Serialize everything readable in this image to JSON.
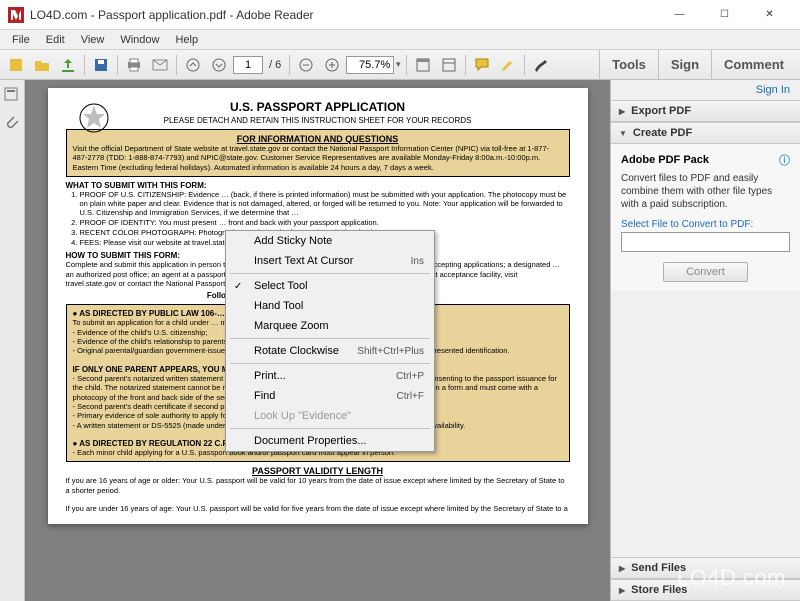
{
  "window": {
    "title": "LO4D.com - Passport application.pdf - Adobe Reader"
  },
  "menubar": [
    "File",
    "Edit",
    "View",
    "Window",
    "Help"
  ],
  "toolbar": {
    "page_current": "1",
    "page_total": "/ 6",
    "zoom": "75.7%"
  },
  "toolbar_tabs": {
    "tools": "Tools",
    "sign": "Sign",
    "comment": "Comment"
  },
  "right": {
    "signin": "Sign In",
    "export": "Export PDF",
    "create": "Create PDF",
    "pack_title": "Adobe PDF Pack",
    "pack_desc": "Convert files to PDF and easily combine them with other file types with a paid subscription.",
    "select_label": "Select File to Convert to PDF:",
    "convert": "Convert",
    "send": "Send Files",
    "store": "Store Files"
  },
  "context_menu": {
    "add_sticky": "Add Sticky Note",
    "insert_text": "Insert Text At Cursor",
    "insert_text_sc": "Ins",
    "select_tool": "Select Tool",
    "hand_tool": "Hand Tool",
    "marquee_zoom": "Marquee Zoom",
    "rotate_cw": "Rotate Clockwise",
    "rotate_cw_sc": "Shift+Ctrl+Plus",
    "print": "Print...",
    "print_sc": "Ctrl+P",
    "find": "Find",
    "find_sc": "Ctrl+F",
    "lookup": "Look Up \"Evidence\"",
    "doc_props": "Document Properties..."
  },
  "doc": {
    "title": "U.S. PASSPORT APPLICATION",
    "subtitle": "PLEASE DETACH AND RETAIN THIS INSTRUCTION SHEET FOR YOUR RECORDS",
    "info_hdr": "FOR INFORMATION AND QUESTIONS",
    "info_body": "Visit the official Department of State website at travel.state.gov or contact the National Passport Information Center (NPIC) via toll-free at 1-877-487-2778 (TDD: 1-888-874-7793) and NPIC@state.gov.  Customer Service Representatives are available Monday-Friday 8:00a.m.-10:00p.m. Eastern Time (excluding federal holidays). Automated information is available 24 hours a day, 7 days a week.",
    "what_submit": "WHAT TO SUBMIT WITH THIS FORM:",
    "what_items": [
      "PROOF OF U.S. CITIZENSHIP: Evidence … (back, if there is printed information) must be submitted with your application. The photocopy must be on plain white paper and clear. Evidence that is not damaged, altered, or forged will be returned to you. Note: Your application will be forwarded to U.S. Citizenship and Immigration Services, if we determine that …",
      "PROOF OF IDENTITY: You must present … front and back with your passport application.",
      "RECENT COLOR PHOTOGRAPH: Photograph must be … the face and 2x2 inches in size.",
      "FEES: Please visit our website at travel.state.gov."
    ],
    "how_submit": "HOW TO SUBMIT THIS FORM:",
    "how_body": "Complete and submit this application in person to a state court of record or a judge or clerk of a probate court accepting applications; a designated … an authorized post office; an agent at a passport agency (by appointment only); or a U.S. … To find your nearest acceptance facility, visit travel.state.gov or contact the National Passport Information Center.",
    "follow": "Follow the instructions on … and submission of this form.",
    "law_hdr": "AS DIRECTED BY PUBLIC LAW 106-…",
    "law_body1": "To submit an application for a child under … must appear and present the following:",
    "law_items": [
      "Evidence of the child's U.S. citizenship;",
      "Evidence of the child's relationship to parents/guardian(s); AND",
      "Original parental/guardian government-issued identification AND a photocopy of the front and back side of presented identification."
    ],
    "one_parent_hdr": "IF ONLY ONE PARENT APPEARS, YOU MUST ALSO SUBMIT ONE OF THE FOLLOWING:",
    "one_parent_items": [
      "Second parent's notarized written statement or DS-3053 (including the child's full name and date of birth) consenting to the passport issuance for the child. The notarized statement cannot be more than three months old and must be signed and notarized on a form and must come with a photocopy of the front and back side of the second parent's government-issued photo identification; OR",
      "Second parent's death certificate if second parent is deceased; OR",
      "Primary evidence of sole authority to apply for the child; OR",
      "A written statement or DS-5525 (made under penalty of perjury) explaining in detail the second parent's unavailability."
    ],
    "reg_hdr": "AS DIRECTED BY REGULATION 22 C.F.R. 51.21 AND 51.28:",
    "reg_item": "Each minor child applying for a U.S. passport book and/or passport card must appear in person.",
    "validity_hdr": "PASSPORT VALIDITY LENGTH",
    "validity_16_over": "If you are 16 years of age or older: Your U.S. passport will be valid for 10 years from the date of issue except where limited by the Secretary of State to a shorter period.",
    "validity_16_under": "If you are under 16 years of age: Your U.S. passport will be valid for five years from the date of issue except where limited by the Secretary of State to a"
  },
  "watermark": "LO4D.com"
}
